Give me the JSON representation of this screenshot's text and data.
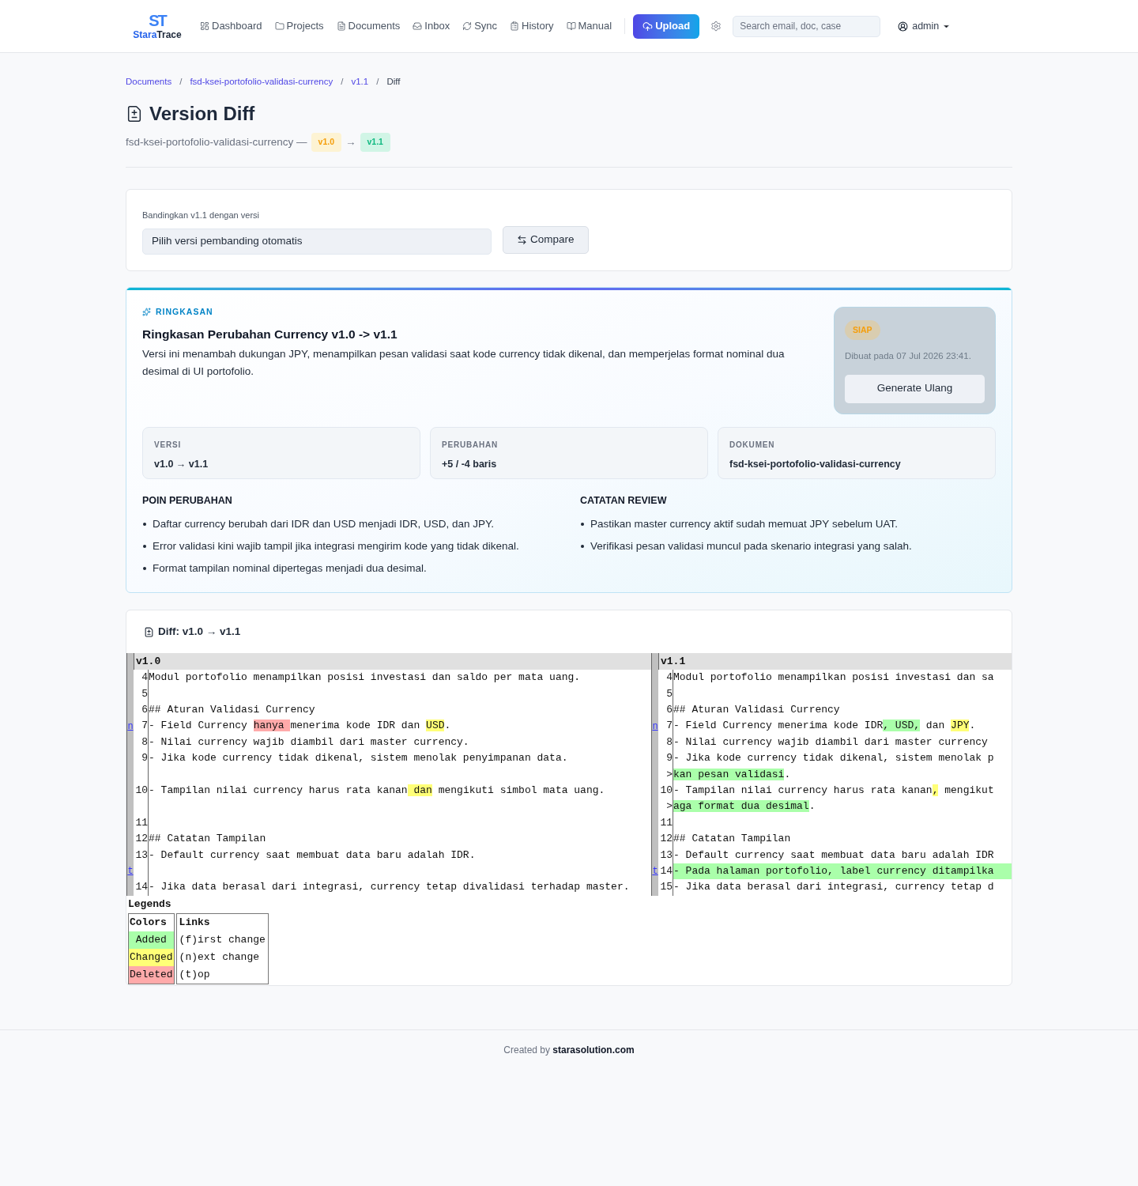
{
  "nav": {
    "logo": {
      "mark": "ST",
      "name_first": "Stara",
      "name_second": "Trace"
    },
    "items": [
      {
        "label": "Dashboard"
      },
      {
        "label": "Projects"
      },
      {
        "label": "Documents"
      },
      {
        "label": "Inbox"
      },
      {
        "label": "Sync"
      },
      {
        "label": "History"
      },
      {
        "label": "Manual"
      }
    ],
    "upload": "Upload",
    "search": {
      "placeholder": "Search email, doc, case"
    },
    "user": "admin"
  },
  "breadcrumb": [
    {
      "label": "Documents",
      "current": false
    },
    {
      "separator": "/",
      "label": "fsd-ksei-portofolio-validasi-currency",
      "current": false
    },
    {
      "separator": "/",
      "label": "v1.1",
      "current": false
    },
    {
      "separator": "/",
      "label": "Diff",
      "current": true
    }
  ],
  "page": {
    "title": "Version Diff",
    "document": "fsd-ksei-portofolio-validasi-currency —",
    "from": "v1.0",
    "arrow": "→",
    "to": "v1.1"
  },
  "compare": {
    "label": "Bandingkan v1.1 dengan versi",
    "select_value": "Pilih versi pembanding otomatis",
    "button": "Compare"
  },
  "summary": {
    "eyebrow": "RINGKASAN",
    "title": "Ringkasan Perubahan Currency v1.0 -> v1.1",
    "description": "Versi ini menambah dukungan JPY, menampilkan pesan validasi saat kode currency tidak dikenal, dan memperjelas format nominal dua desimal di UI portofolio.",
    "status": "SIAP",
    "created": "Dibuat pada 07 Jul 2026 23:41.",
    "regenerate": "Generate Ulang",
    "stats": [
      {
        "label": "VERSI",
        "value": "v1.0 → v1.1"
      },
      {
        "label": "PERUBAHAN",
        "value": "+5 / -4 baris"
      },
      {
        "label": "DOKUMEN",
        "value": "fsd-ksei-portofolio-validasi-currency"
      }
    ],
    "lists": [
      {
        "title": "POIN PERUBAHAN",
        "items": [
          "Daftar currency berubah dari IDR dan USD menjadi IDR, USD, dan JPY.",
          "Error validasi kini wajib tampil jika integrasi mengirim kode yang tidak dikenal.",
          "Format tampilan nominal dipertegas menjadi dua desimal."
        ]
      },
      {
        "title": "CATATAN REVIEW",
        "items": [
          "Pastikan master currency aktif sudah memuat JPY sebelum UAT.",
          "Verifikasi pesan validasi muncul pada skenario integrasi yang salah."
        ]
      }
    ]
  },
  "diff": {
    "title": "Diff: v1.0 → v1.1",
    "left_header": "v1.0",
    "right_header": "v1.1",
    "rows": [
      {
        "left": {
          "num": "4",
          "segments": [
            {
              "text": "Modul portofolio menampilkan posisi investasi dan saldo per mata uang.",
              "kind": "plain"
            }
          ]
        },
        "right": {
          "num": "4",
          "segments": [
            {
              "text": "Modul portofolio menampilkan posisi investasi dan sa",
              "kind": "plain"
            }
          ]
        }
      },
      {
        "left": {
          "num": "5"
        },
        "right": {
          "num": "5"
        }
      },
      {
        "left": {
          "num": "6",
          "segments": [
            {
              "text": "## Aturan Validasi Currency",
              "kind": "plain"
            }
          ]
        },
        "right": {
          "num": "6",
          "segments": [
            {
              "text": "## Aturan Validasi Currency",
              "kind": "plain"
            }
          ]
        }
      },
      {
        "left": {
          "link": "n",
          "num": "7",
          "segments": [
            {
              "text": "- Field Currency ",
              "kind": "plain"
            },
            {
              "text": "hanya ",
              "kind": "deleted"
            },
            {
              "text": "menerima kode IDR dan ",
              "kind": "plain"
            },
            {
              "text": "USD",
              "kind": "changed"
            },
            {
              "text": ".",
              "kind": "plain"
            }
          ]
        },
        "right": {
          "link": "n",
          "num": "7",
          "segments": [
            {
              "text": "- Field Currency menerima kode IDR",
              "kind": "plain"
            },
            {
              "text": ", USD,",
              "kind": "added"
            },
            {
              "text": " dan ",
              "kind": "plain"
            },
            {
              "text": "JPY",
              "kind": "changed"
            },
            {
              "text": ".",
              "kind": "plain"
            }
          ]
        }
      },
      {
        "left": {
          "num": "8",
          "segments": [
            {
              "text": "- Nilai currency wajib diambil dari master currency.",
              "kind": "plain"
            }
          ]
        },
        "right": {
          "num": "8",
          "segments": [
            {
              "text": "- Nilai currency wajib diambil dari master currency",
              "kind": "plain"
            }
          ]
        }
      },
      {
        "left": {
          "num": "9",
          "segments": [
            {
              "text": "- Jika kode currency tidak dikenal, sistem menolak penyimpanan data.",
              "kind": "plain"
            }
          ]
        },
        "right": {
          "num": "9",
          "segments": [
            {
              "text": "- Jika kode currency tidak dikenal, sistem menolak p",
              "kind": "plain"
            }
          ]
        }
      },
      {
        "left": {},
        "right": {
          "num": ">",
          "segments": [
            {
              "text": "kan pesan validasi",
              "kind": "added"
            },
            {
              "text": ".",
              "kind": "plain"
            }
          ]
        }
      },
      {
        "left": {
          "num": "10",
          "segments": [
            {
              "text": "- Tampilan nilai currency harus rata kanan",
              "kind": "plain"
            },
            {
              "text": " dan",
              "kind": "changed"
            },
            {
              "text": " mengikuti simbol mata uang.",
              "kind": "plain"
            }
          ]
        },
        "right": {
          "num": "10",
          "segments": [
            {
              "text": "- Tampilan nilai currency harus rata kanan",
              "kind": "plain"
            },
            {
              "text": ",",
              "kind": "changed"
            },
            {
              "text": " mengikut",
              "kind": "plain"
            }
          ]
        }
      },
      {
        "left": {},
        "right": {
          "num": ">",
          "segments": [
            {
              "text": "aga format dua desimal",
              "kind": "added"
            },
            {
              "text": ".",
              "kind": "plain"
            }
          ]
        }
      },
      {
        "left": {
          "num": "11"
        },
        "right": {
          "num": "11"
        }
      },
      {
        "left": {
          "num": "12",
          "segments": [
            {
              "text": "## Catatan Tampilan",
              "kind": "plain"
            }
          ]
        },
        "right": {
          "num": "12",
          "segments": [
            {
              "text": "## Catatan Tampilan",
              "kind": "plain"
            }
          ]
        }
      },
      {
        "left": {
          "num": "13",
          "segments": [
            {
              "text": "- Default currency saat membuat data baru adalah IDR.",
              "kind": "plain"
            }
          ]
        },
        "right": {
          "num": "13",
          "segments": [
            {
              "text": "- Default currency saat membuat data baru adalah IDR",
              "kind": "plain"
            }
          ]
        }
      },
      {
        "left": {
          "link": "t"
        },
        "right": {
          "link": "t",
          "num": "14",
          "full_added": true,
          "segments": [
            {
              "text": "- Pada halaman portofolio, label currency ditampilka",
              "kind": "added"
            }
          ]
        }
      },
      {
        "left": {
          "num": "14",
          "segments": [
            {
              "text": "- Jika data berasal dari integrasi, currency tetap divalidasi terhadap master.",
              "kind": "plain"
            }
          ]
        },
        "right": {
          "num": "15",
          "segments": [
            {
              "text": "- Jika data berasal dari integrasi, currency tetap d",
              "kind": "plain"
            }
          ]
        }
      }
    ],
    "legend": {
      "title": "Legends",
      "colors_header": "Colors",
      "links_header": "Links",
      "colors": [
        {
          "label": "Added",
          "kind": "added"
        },
        {
          "label": "Changed",
          "kind": "changed"
        },
        {
          "label": "Deleted",
          "kind": "deleted"
        }
      ],
      "links": [
        "(f)irst change",
        "(n)ext change",
        "(t)op"
      ]
    }
  },
  "footer": "Created by **starasolution.com**"
}
